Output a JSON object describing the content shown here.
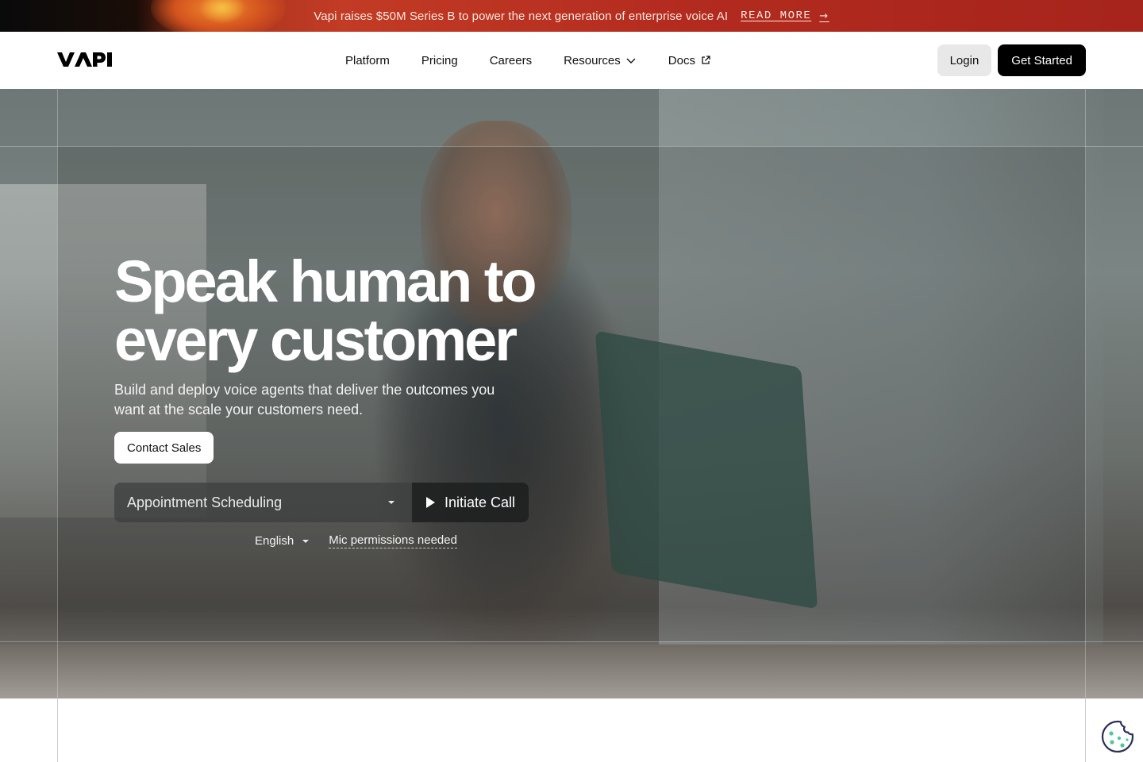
{
  "announcement": {
    "text": "Vapi raises $50M Series B to power the next generation of enterprise voice AI",
    "link_label": "READ MORE",
    "arrow": "→"
  },
  "nav": {
    "logo_text": "VAPI",
    "links": [
      {
        "label": "Platform"
      },
      {
        "label": "Pricing"
      },
      {
        "label": "Careers"
      },
      {
        "label": "Resources",
        "icon": "chevron-down-icon"
      },
      {
        "label": "Docs",
        "icon": "external-link-icon"
      }
    ],
    "login_label": "Login",
    "cta_label": "Get Started"
  },
  "hero": {
    "headline_line1": "Speak human to",
    "headline_line2": "every customer",
    "subheading": "Build and deploy voice agents that deliver the outcomes you want at the scale your customers need.",
    "contact_label": "Contact Sales",
    "demo": {
      "selected_use_case": "Appointment Scheduling",
      "call_label": "Initiate Call",
      "language": "English",
      "mic_status": "Mic permissions needed"
    }
  },
  "colors": {
    "banner_accent": "#c23b25",
    "primary_button": "#000000",
    "cookie_icon": "#2a2f5a",
    "cookie_dots": "#4cc9a0"
  }
}
